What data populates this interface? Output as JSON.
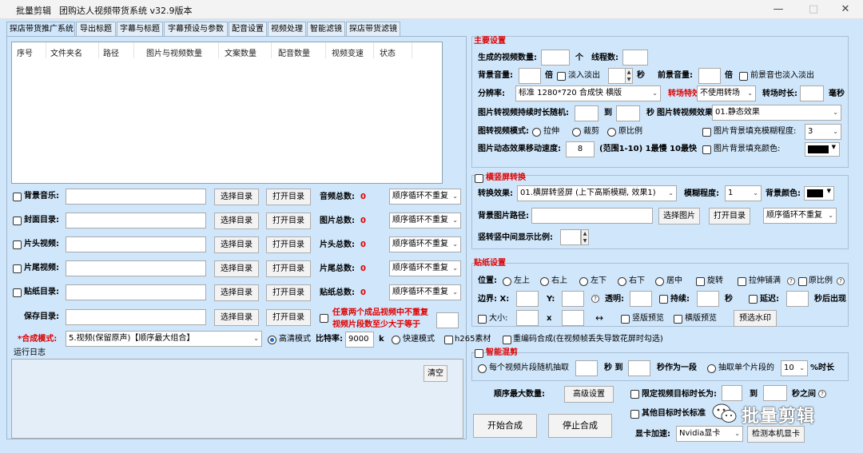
{
  "window": {
    "app_name": "批量剪辑",
    "title": "团购达人视频带货系统  v32.9版本",
    "minimize": "—",
    "maximize": "□",
    "close": "✕"
  },
  "tabs": [
    "探店带货推广系统",
    "导出标题",
    "字幕与标题",
    "字幕预设与参数",
    "配音设置",
    "视频处理",
    "智能滤镜",
    "探店带货滤镜"
  ],
  "table": {
    "columns": [
      "序号",
      "文件夹名",
      "路径",
      "图片与视频数量",
      "文案数量",
      "配音数量",
      "视频变速",
      "状态"
    ]
  },
  "material_rows": [
    {
      "label": "背景音乐:",
      "select": "选择目录",
      "open": "打开目录",
      "total_label": "音频总数:",
      "total": "0",
      "mode": "顺序循环不重复"
    },
    {
      "label": "封面目录:",
      "select": "选择目录",
      "open": "打开目录",
      "total_label": "图片总数:",
      "total": "0",
      "mode": "顺序循环不重复"
    },
    {
      "label": "片头视频:",
      "select": "选择目录",
      "open": "打开目录",
      "total_label": "片头总数:",
      "total": "0",
      "mode": "顺序循环不重复"
    },
    {
      "label": "片尾视频:",
      "select": "选择目录",
      "open": "打开目录",
      "total_label": "片尾总数:",
      "total": "0",
      "mode": "顺序循环不重复"
    },
    {
      "label": "贴纸目录:",
      "select": "选择目录",
      "open": "打开目录",
      "total_label": "贴纸总数:",
      "total": "0",
      "mode": "顺序循环不重复"
    }
  ],
  "save": {
    "label": "保存目录:",
    "select": "选择目录",
    "open": "打开目录",
    "warning_line1": "任意两个成品视频中不重复",
    "warning_line2": "视频片段数至少大于等于"
  },
  "compose": {
    "label": "*合成模式:",
    "mode": "5.视频(保留原声)【顺序最大组合】",
    "hq": "高清模式",
    "bitrate_label": "比特率:",
    "bitrate": "9000",
    "bitrate_unit": "k",
    "fast": "快速模式",
    "h265": "h265素材",
    "reencode": "重编码合成(在视频帧丢失导致花屏时勾选)"
  },
  "log": {
    "label": "运行日志",
    "clear": "清空"
  },
  "main_settings": {
    "title": "主要设置",
    "gen_count_label": "生成的视频数量:",
    "gen_unit": "个",
    "threads_label": "线程数:",
    "bg_vol_label": "背景音量:",
    "times1": "倍",
    "fade": "淡入淡出",
    "seconds": "秒",
    "fg_vol_label": "前景音量:",
    "times2": "倍",
    "fg_fade": "前景音也淡入淡出",
    "res_label": "分辨率:",
    "res_value": "标准 1280*720 合成快 横版",
    "trans_label": "转场特效:",
    "trans_value": "不使用转场",
    "trans_len_label": "转场时长:",
    "ms": "毫秒",
    "img_dur_label": "图片转视频持续时长随机:",
    "to": "到",
    "sec": "秒",
    "img_effect_label": "图片转视频效果:",
    "img_effect_value": "01.静态效果",
    "img_mode_label": "图转视频模式:",
    "stretch": "拉伸",
    "crop": "裁剪",
    "original": "原比例",
    "blur_bg_label": "图片背景填充模糊程度:",
    "blur_bg_value": "3",
    "speed_label": "图片动态效果移动速度:",
    "speed_value": "8",
    "speed_hint": "(范围1-10) 1最慢 10最快",
    "fill_color_label": "图片背景填充颜色:"
  },
  "hv": {
    "title": "横竖屏转换",
    "effect_label": "转换效果:",
    "effect_value": "01.横屏转竖屏 (上下高斯模糊, 效果1)",
    "blur_label": "模糊程度:",
    "blur_value": "1",
    "bg_color_label": "背景颜色:",
    "bg_img_label": "背景图片路径:",
    "select_img": "选择图片",
    "open_dir": "打开目录",
    "mode": "顺序循环不重复",
    "ratio_label": "竖转竖中间显示比例:"
  },
  "sticker": {
    "title": "贴纸设置",
    "pos_label": "位置:",
    "pos": [
      "左上",
      "右上",
      "左下",
      "右下",
      "居中"
    ],
    "rotate": "旋转",
    "stretch_fill": "拉伸铺满",
    "keep_ratio": "原比例",
    "margin_label": "边界: X:",
    "y_label": "Y:",
    "alpha_label": "透明:",
    "dur_label": "持续:",
    "sec": "秒",
    "delay_label": "延迟:",
    "after": "秒后出现",
    "size_label": "大小:",
    "x": "x",
    "arrows": "↔",
    "v_preview": "竖版预览",
    "h_preview": "横版预览",
    "pick": "预选水印"
  },
  "smart": {
    "title": "智能混剪",
    "each_label": "每个视频片段随机抽取",
    "sec_to": "秒 到",
    "as_seg": "秒作为一段",
    "extract_label": "抽取单个片段的",
    "extract_value": "10",
    "pct": "%时长",
    "max_label": "顺序最大数量:",
    "advanced": "高级设置",
    "limit_label": "限定视频目标时长为:",
    "to": "到",
    "between": "秒之间",
    "other_label": "其他目标时长标准"
  },
  "actions": {
    "start": "开始合成",
    "stop": "停止合成",
    "gpu_label": "显卡加速:",
    "gpu_value": "Nvidia显卡",
    "detect": "检测本机显卡"
  },
  "watermark": "批量剪辑"
}
